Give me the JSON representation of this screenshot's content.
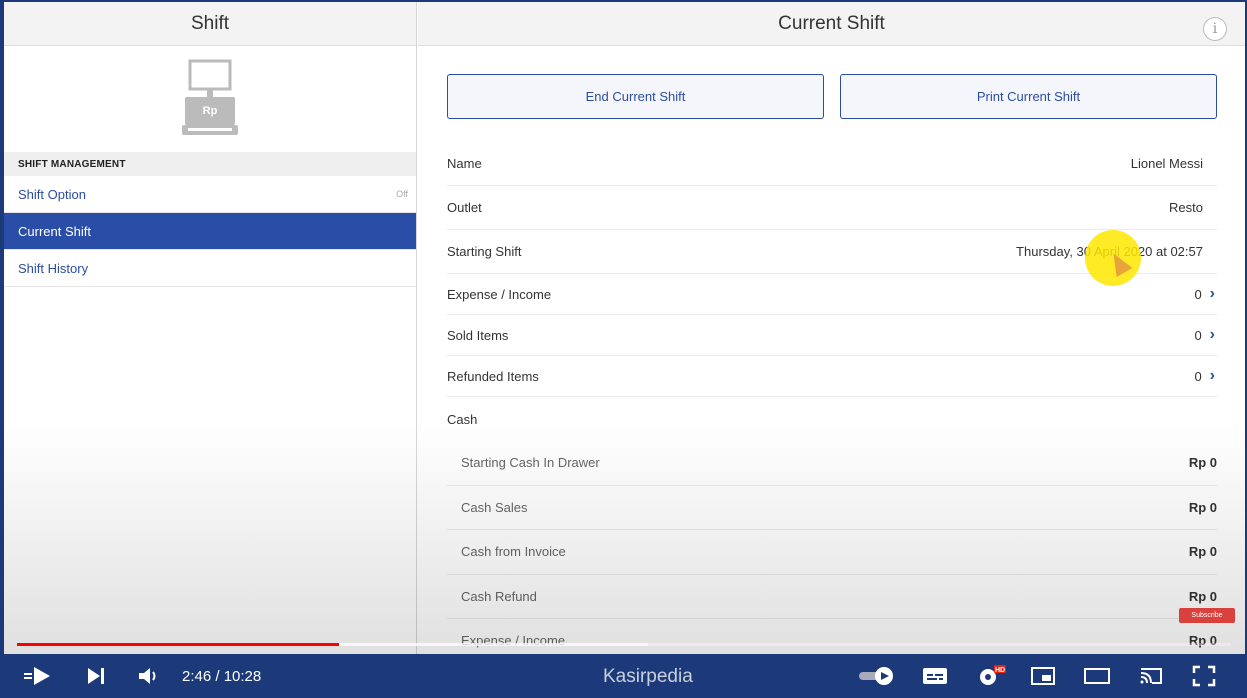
{
  "left": {
    "title": "Shift",
    "section_label": "SHIFT MANAGEMENT",
    "register_badge": "Rp",
    "items": [
      {
        "label": "Shift Option",
        "status": "Off"
      },
      {
        "label": "Current Shift"
      },
      {
        "label": "Shift History"
      }
    ]
  },
  "right": {
    "title": "Current Shift",
    "info_glyph": "i",
    "buttons": {
      "end": "End Current Shift",
      "print": "Print Current Shift"
    },
    "details": {
      "name_label": "Name",
      "name_value": "Lionel Messi",
      "outlet_label": "Outlet",
      "outlet_value": "Resto",
      "start_label": "Starting Shift",
      "start_value": "Thursday, 30 April 2020 at 02:57",
      "expense_label": "Expense / Income",
      "expense_value": "0",
      "sold_label": "Sold Items",
      "sold_value": "0",
      "refunded_label": "Refunded Items",
      "refunded_value": "0",
      "cash_label": "Cash"
    },
    "cash_rows": [
      {
        "label": "Starting Cash In Drawer",
        "value": "Rp 0"
      },
      {
        "label": "Cash Sales",
        "value": "Rp 0"
      },
      {
        "label": "Cash from Invoice",
        "value": "Rp 0"
      },
      {
        "label": "Cash Refund",
        "value": "Rp 0"
      },
      {
        "label": "Expense / Income",
        "value": "Rp 0"
      }
    ],
    "chevron_icon": "chevron-right-icon"
  },
  "overlay": {
    "subscribe_label": "Subscribe"
  },
  "player": {
    "time": "2:46 / 10:28",
    "channel": "Kasirpedia",
    "hd_badge": "HD",
    "progress": 0.265,
    "buffered": 0.52,
    "accent": "#ff0000"
  }
}
